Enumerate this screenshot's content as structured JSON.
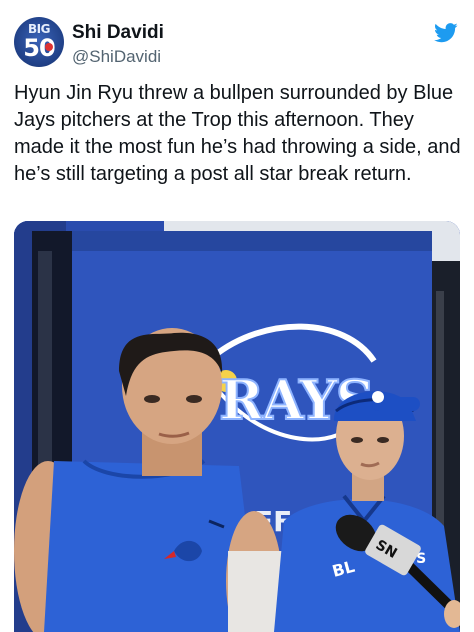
{
  "author": {
    "avatar_top": "BIG",
    "avatar_number": "50",
    "display_name": "Shi Davidi",
    "handle": "@ShiDavidi"
  },
  "platform_icon": "twitter-bird-icon",
  "tweet": {
    "text": "Hyun Jin Ryu threw a bullpen surrounded by Blue Jays pitchers at the Trop this afternoon. They made it the most fun he’s had throwing a side, and he’s still targeting a post all star break return."
  },
  "photo": {
    "wall_logo": "RAYS",
    "mic_flag": "SN",
    "colors": {
      "wall": "#2c4fb5",
      "jersey": "#2d62d6",
      "accent": "#1d9bf0"
    }
  }
}
